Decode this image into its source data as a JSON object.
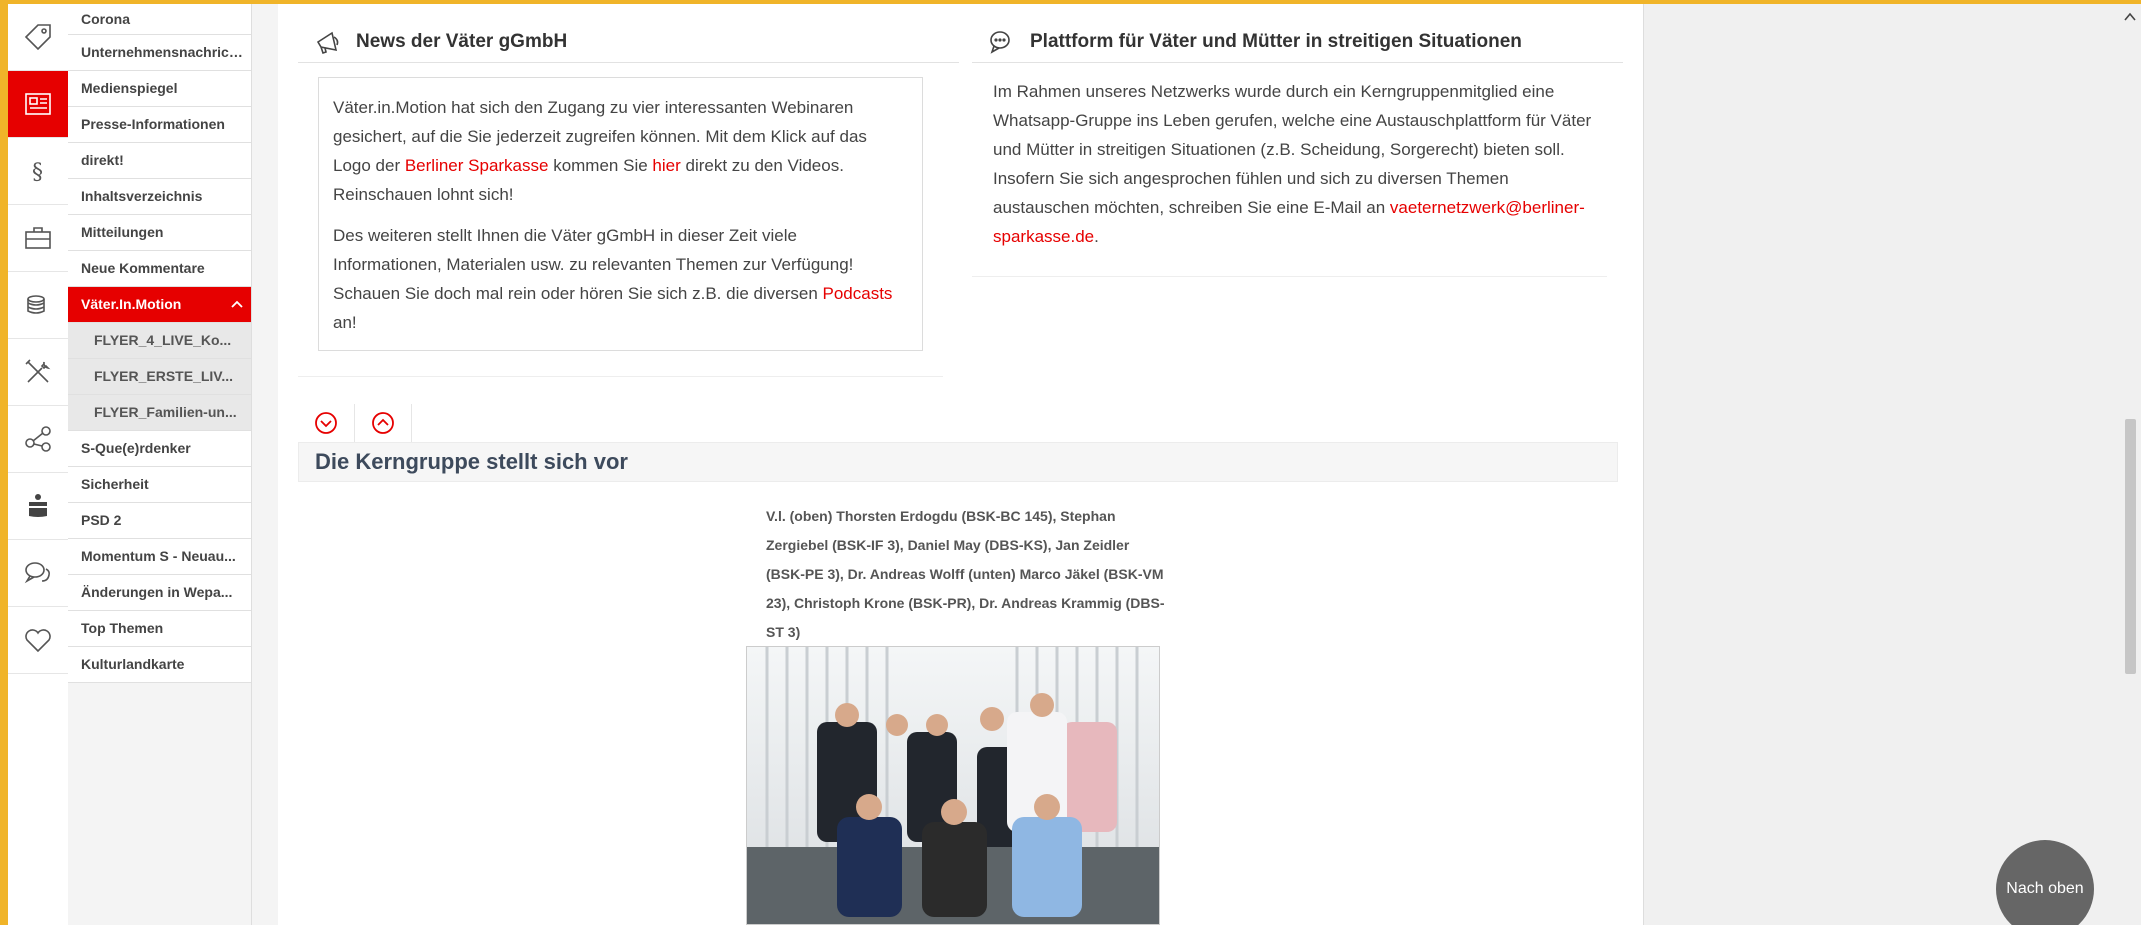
{
  "rail": {
    "icons": [
      "price-tag-icon",
      "newspaper-icon",
      "paragraph-icon",
      "briefcase-icon",
      "coins-icon",
      "tools-icon",
      "share-icon",
      "savings-bank-icon",
      "chat-bubbles-icon",
      "heart-icon"
    ],
    "active_index": 1,
    "accent": "#e60000"
  },
  "sidebar": {
    "items": [
      {
        "label": "Corona"
      },
      {
        "label": "Unternehmensnachrichten"
      },
      {
        "label": "Medienspiegel"
      },
      {
        "label": "Presse-Informationen"
      },
      {
        "label": "direkt!"
      },
      {
        "label": "Inhaltsverzeichnis"
      },
      {
        "label": "Mitteilungen"
      },
      {
        "label": "Neue Kommentare"
      },
      {
        "label": "Väter.In.Motion"
      },
      {
        "label": "FLYER_4_LIVE_Ko..."
      },
      {
        "label": "FLYER_ERSTE_LIV..."
      },
      {
        "label": "FLYER_Familien-un..."
      },
      {
        "label": "S-Que(e)rdenker"
      },
      {
        "label": "Sicherheit"
      },
      {
        "label": "PSD 2"
      },
      {
        "label": "Momentum S - Neuau..."
      },
      {
        "label": "Änderungen in Wepa..."
      },
      {
        "label": "Top Themen"
      },
      {
        "label": "Kulturlandkarte"
      }
    ],
    "active_label": "Väter.In.Motion"
  },
  "news": {
    "title": "News der Väter gGmbH",
    "p1_a": "Väter.in.Motion hat sich den Zugang zu vier interessanten Webinaren gesichert, auf die Sie jederzeit zugreifen können. Mit dem Klick auf das Logo der ",
    "p1_link1": "Berliner Sparkasse",
    "p1_b": " kommen Sie ",
    "p1_link2": "hier",
    "p1_c": " direkt zu den Videos. Reinschauen lohnt sich!",
    "p2_a": "Des weiteren stellt Ihnen die Väter gGmbH in dieser Zeit viele Informationen, Materialen usw. zu relevanten Themen zur Verfügung! Schauen Sie doch mal rein oder hören Sie sich z.B. die diversen ",
    "p2_link": "Podcasts",
    "p2_b": " an!"
  },
  "platform": {
    "title": "Plattform für Väter und Mütter in streitigen Situationen",
    "text": "Im Rahmen unseres Netzwerks wurde durch ein Kerngruppenmitglied eine Whatsapp-Gruppe ins Leben gerufen, welche eine Austauschplattform für Väter und Mütter in streitigen Situationen (z.B. Scheidung, Sorgerecht) bieten soll. Insofern Sie sich angesprochen fühlen und sich zu diversen Themen austauschen möchten, schreiben Sie eine E-Mail an ",
    "email": "vaeternetzwerk@berliner-sparkasse.de",
    "end": "."
  },
  "kerngruppe": {
    "title": "Die Kerngruppe stellt sich vor",
    "caption": "V.l. (oben) Thorsten Erdogdu (BSK-BC 145), Stephan Zergiebel (BSK-IF 3), Daniel May (DBS-KS), Jan Zeidler (BSK-PE 3), Dr. Andreas Wolff (unten) Marco Jäkel (BSK-VM 23), Christoph Krone (BSK-PR), Dr. Andreas Krammig (DBS-ST 3)"
  },
  "back_to_top": "Nach oben"
}
